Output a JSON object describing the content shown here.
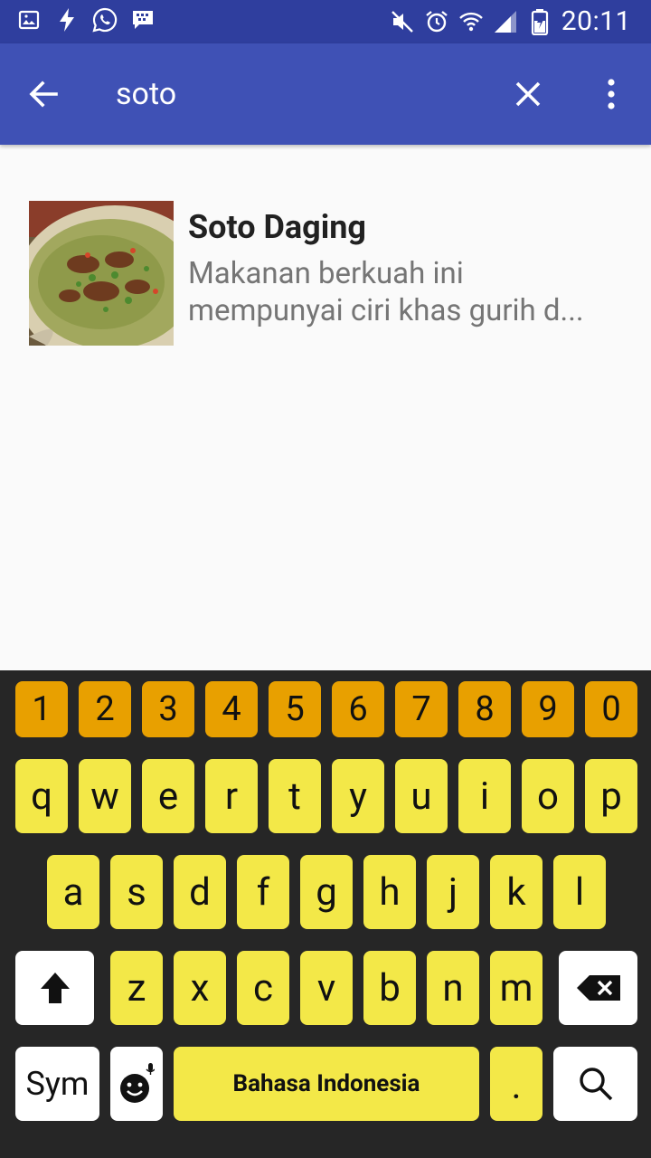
{
  "status_bar": {
    "time": "20:11",
    "left_icons": [
      "gallery-icon",
      "flash-icon",
      "whatsapp-icon",
      "bbm-icon"
    ],
    "right_icons": [
      "mute-icon",
      "alarm-icon",
      "wifi-icon",
      "signal-icon",
      "battery-icon"
    ]
  },
  "app_bar": {
    "search_query": "soto",
    "icons": [
      "back-arrow-icon",
      "close-icon",
      "more-vert-icon"
    ]
  },
  "results": [
    {
      "title": "Soto Daging",
      "description_line1": "Makanan berkuah ini",
      "description_line2": "mempunyai ciri khas gurih d..."
    }
  ],
  "keyboard": {
    "number_row": [
      "1",
      "2",
      "3",
      "4",
      "5",
      "6",
      "7",
      "8",
      "9",
      "0"
    ],
    "row1": [
      "q",
      "w",
      "e",
      "r",
      "t",
      "y",
      "u",
      "i",
      "o",
      "p"
    ],
    "row2": [
      "a",
      "s",
      "d",
      "f",
      "g",
      "h",
      "j",
      "k",
      "l"
    ],
    "row3": [
      "z",
      "x",
      "c",
      "v",
      "b",
      "n",
      "m"
    ],
    "sym_label": "Sym",
    "space_label": "Bahasa Indonesia",
    "period_label": ".",
    "colors": {
      "number_key": "#e8a000",
      "letter_key": "#f3e848",
      "function_key": "#ffffff",
      "background": "#262626"
    }
  },
  "colors": {
    "status_bar": "#2f3e9e",
    "app_bar": "#3f51b5",
    "page_bg": "#fafafa"
  }
}
